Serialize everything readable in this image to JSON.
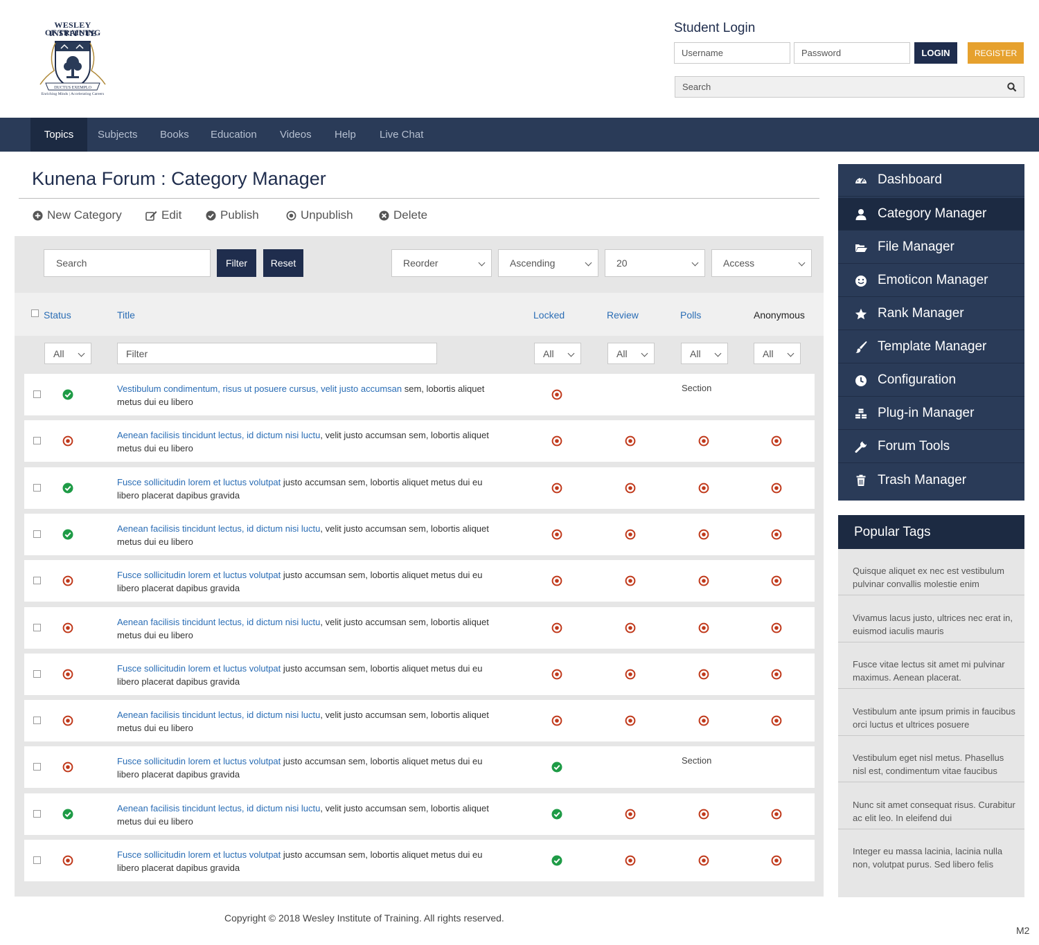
{
  "logo": {
    "line1": "WESLEY INSTITUTE",
    "line2": "OF TRAINING",
    "banner": "DUCTUS EXEMPLO",
    "tagline": "Enriching Minds | Accelerating Careers"
  },
  "login": {
    "title": "Student Login",
    "username_placeholder": "Username",
    "password_placeholder": "Password",
    "login_label": "LOGIN",
    "register_label": "REGISTER",
    "search_placeholder": "Search"
  },
  "colors": {
    "navy": "#2a3b58",
    "navy_dark": "#1c2a42",
    "register": "#e6a12e",
    "link": "#2a6db5",
    "ok_green": "#1e9b46",
    "stop_red": "#c0391b"
  },
  "nav": [
    "Topics",
    "Subjects",
    "Books",
    "Education",
    "Videos",
    "Help",
    "Live Chat"
  ],
  "page": {
    "title": "Kunena Forum : Category Manager",
    "toolbar": [
      "New Category",
      "Edit",
      "Publish",
      "Unpublish",
      "Delete"
    ],
    "filters": {
      "search_placeholder": "Search",
      "filter_label": "Filter",
      "reset_label": "Reset",
      "ordering": "Reorder",
      "direction": "Ascending",
      "limit": "20",
      "access": "Access"
    },
    "columns": {
      "status": "Status",
      "title": "Title",
      "locked": "Locked",
      "review": "Review",
      "polls": "Polls",
      "anonymous": "Anonymous"
    },
    "column_filters": {
      "all": "All",
      "title_placeholder": "Filter"
    },
    "rows": [
      {
        "link": "Vestibulum condimentum, risus ut posuere cursus, velit justo accumsan",
        "rest": " sem, lobortis aliquet metus dui eu libero",
        "status": "ok",
        "locked": "stop",
        "review": "",
        "polls": "Section",
        "anonymous": ""
      },
      {
        "link": "Aenean facilisis tincidunt lectus, id dictum nisi luctu",
        "rest": ", velit justo accumsan sem, lobortis aliquet metus dui eu libero",
        "status": "stop",
        "locked": "stop",
        "review": "stop",
        "polls": "stop",
        "anonymous": "stop"
      },
      {
        "link": "Fusce sollicitudin lorem et luctus volutpat",
        "rest": " justo accumsan sem, lobortis aliquet metus dui eu libero placerat dapibus gravida",
        "status": "ok",
        "locked": "stop",
        "review": "stop",
        "polls": "stop",
        "anonymous": "stop"
      },
      {
        "link": "Aenean facilisis tincidunt lectus, id dictum nisi luctu",
        "rest": ", velit justo accumsan sem, lobortis aliquet metus dui eu libero",
        "status": "ok",
        "locked": "stop",
        "review": "stop",
        "polls": "stop",
        "anonymous": "stop"
      },
      {
        "link": "Fusce sollicitudin lorem et luctus volutpat",
        "rest": " justo accumsan sem, lobortis aliquet metus dui eu libero placerat dapibus gravida",
        "status": "stop",
        "locked": "stop",
        "review": "stop",
        "polls": "stop",
        "anonymous": "stop"
      },
      {
        "link": "Aenean facilisis tincidunt lectus, id dictum nisi luctu",
        "rest": ", velit justo accumsan sem, lobortis aliquet metus dui eu libero",
        "status": "stop",
        "locked": "stop",
        "review": "stop",
        "polls": "stop",
        "anonymous": "stop"
      },
      {
        "link": "Fusce sollicitudin lorem et luctus volutpat",
        "rest": " justo accumsan sem, lobortis aliquet metus dui eu libero placerat dapibus gravida",
        "status": "stop",
        "locked": "stop",
        "review": "stop",
        "polls": "stop",
        "anonymous": "stop"
      },
      {
        "link": "Aenean facilisis tincidunt lectus, id dictum nisi luctu",
        "rest": ", velit justo accumsan sem, lobortis aliquet metus dui eu libero",
        "status": "stop",
        "locked": "stop",
        "review": "stop",
        "polls": "stop",
        "anonymous": "stop"
      },
      {
        "link": "Fusce sollicitudin lorem et luctus volutpat",
        "rest": " justo accumsan sem, lobortis aliquet metus dui eu libero placerat dapibus gravida",
        "status": "stop",
        "locked": "ok",
        "review": "",
        "polls": "Section",
        "anonymous": ""
      },
      {
        "link": "Aenean facilisis tincidunt lectus, id dictum nisi luctu",
        "rest": ", velit justo accumsan sem, lobortis aliquet metus dui eu libero",
        "status": "ok",
        "locked": "ok",
        "review": "stop",
        "polls": "stop",
        "anonymous": "stop"
      },
      {
        "link": "Fusce sollicitudin lorem et luctus volutpat",
        "rest": " justo accumsan sem, lobortis aliquet metus dui eu libero placerat dapibus gravida",
        "status": "stop",
        "locked": "ok",
        "review": "stop",
        "polls": "stop",
        "anonymous": "stop"
      }
    ]
  },
  "sidebar": {
    "items": [
      {
        "label": "Dashboard",
        "icon": "dashboard-icon"
      },
      {
        "label": "Category Manager",
        "icon": "user-icon"
      },
      {
        "label": "File Manager",
        "icon": "folder-open-icon"
      },
      {
        "label": "Emoticon Manager",
        "icon": "smile-icon"
      },
      {
        "label": "Rank Manager",
        "icon": "star-icon"
      },
      {
        "label": "Template Manager",
        "icon": "brush-icon"
      },
      {
        "label": "Configuration",
        "icon": "clock-icon"
      },
      {
        "label": "Plug-in Manager",
        "icon": "cubes-icon"
      },
      {
        "label": "Forum Tools",
        "icon": "wrench-icon"
      },
      {
        "label": "Trash Manager",
        "icon": "trash-icon"
      }
    ],
    "active": "Category Manager",
    "tags_title": "Popular Tags",
    "tags": [
      "Quisque aliquet ex nec est vestibulum pulvinar convallis molestie enim",
      "Vivamus lacus justo, ultrices nec erat in, euismod iaculis mauris",
      "Fusce vitae lectus sit amet mi pulvinar maximus. Aenean placerat.",
      "Vestibulum ante ipsum primis in faucibus orci luctus et ultrices posuere",
      "Vestibulum eget nisl metus. Phasellus nisl est, condimentum vitae faucibus",
      "Nunc sit amet consequat risus. Curabitur ac elit leo. In eleifend dui",
      "Integer eu massa lacinia, lacinia nulla non, volutpat purus. Sed libero felis"
    ]
  },
  "footer": {
    "copyright": "Copyright  ©  2018 Wesley Institute of Training.   All rights reserved.",
    "corner": "M2"
  }
}
